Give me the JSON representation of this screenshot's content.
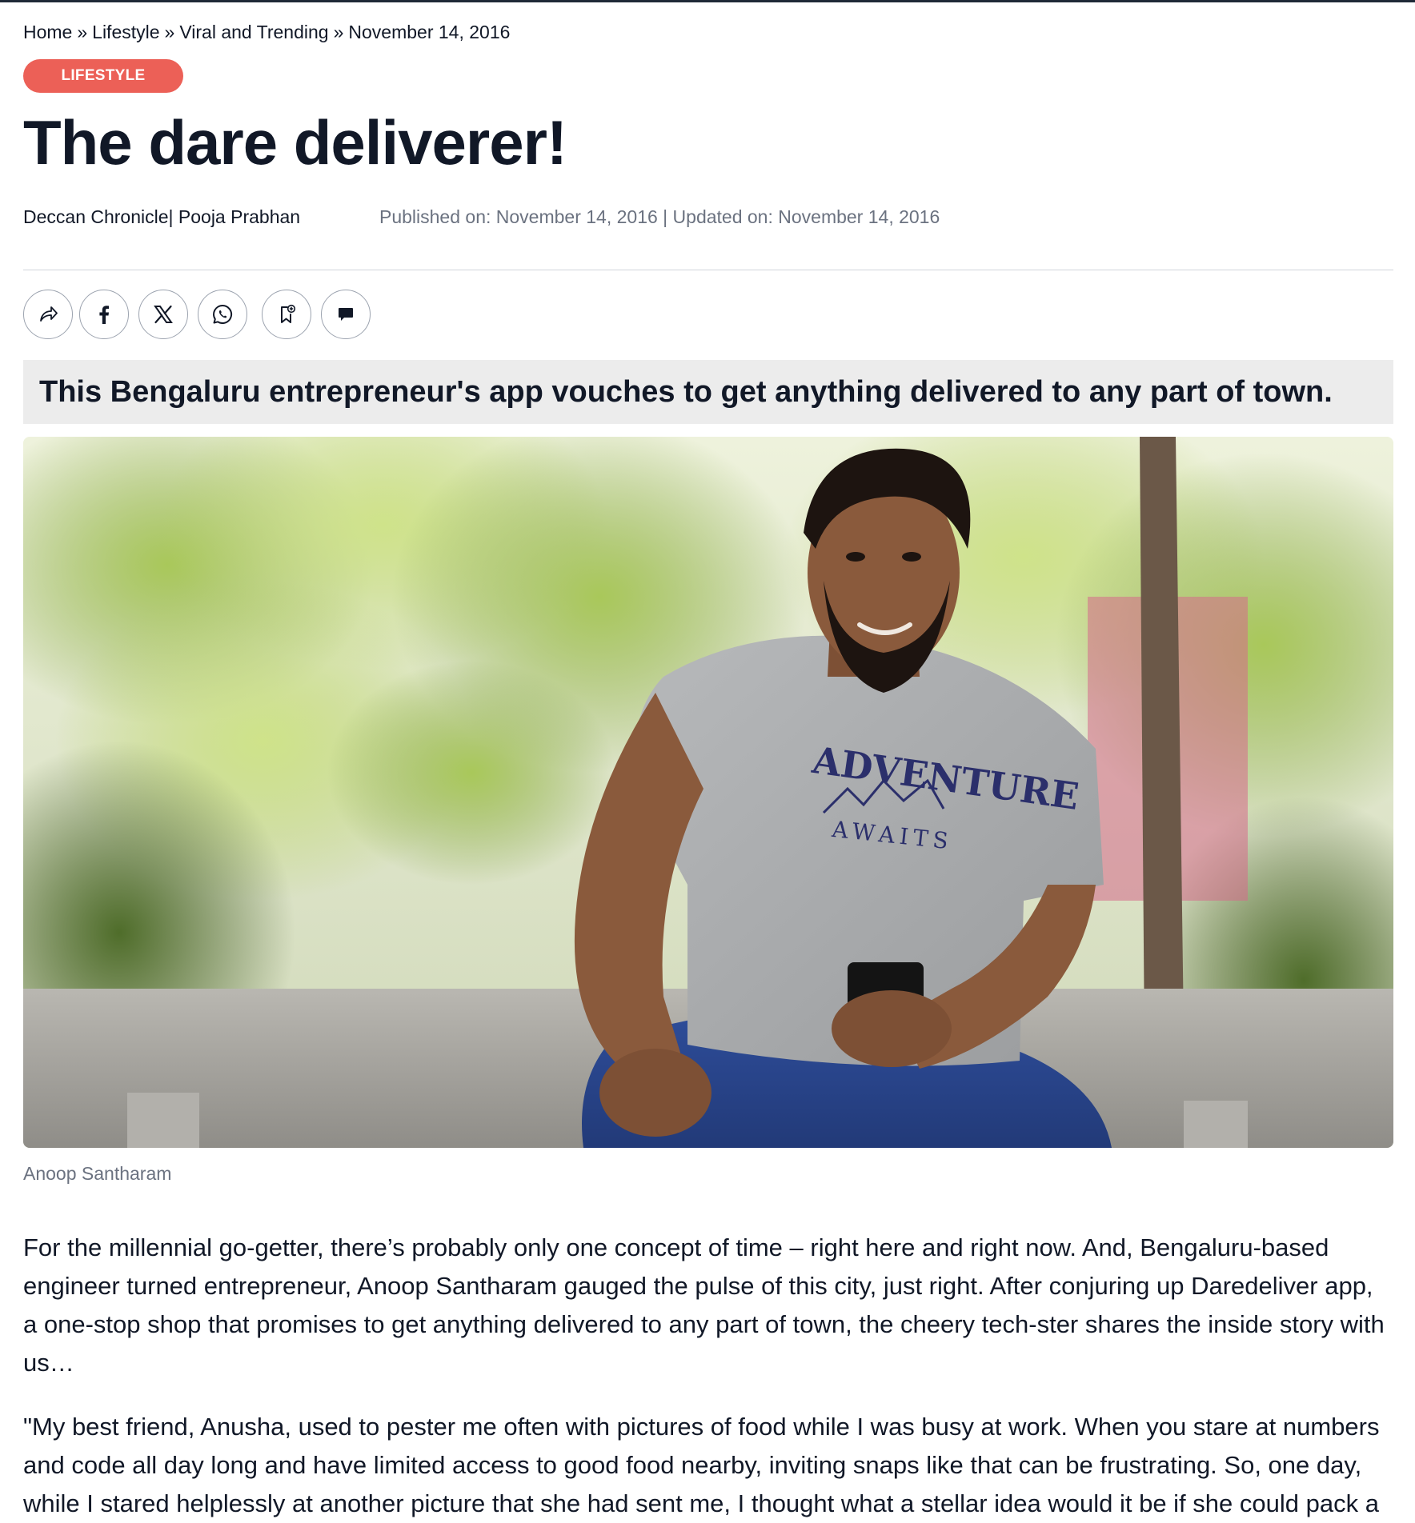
{
  "breadcrumb": {
    "items": [
      "Home",
      "Lifestyle",
      "Viral and Trending",
      "November 14, 2016"
    ],
    "separator": "»"
  },
  "category": "LIFESTYLE",
  "headline": "The dare deliverer!",
  "byline": "Deccan Chronicle| Pooja Prabhan",
  "dates": "Published on: November 14, 2016 | Updated on: November 14, 2016",
  "share": {
    "icons": [
      "share-icon",
      "facebook-icon",
      "x-icon",
      "whatsapp-icon",
      "bookmark-icon",
      "comment-icon"
    ]
  },
  "subheadline": "This Bengaluru entrepreneur's app vouches to get anything delivered to any part of town.",
  "hero": {
    "shirt_text_line1": "ADVENTURE",
    "shirt_text_line2": "AWAITS"
  },
  "caption": "Anoop Santharam",
  "body": {
    "p1": "For the millennial go-getter, there’s probably only one concept of time – right here and right now. And, Bengaluru-based engineer turned entrepreneur, Anoop Santharam gauged the pulse of this city, just right. After conjuring up Daredeliver app, a one-stop shop that promises to get anything delivered to any part of town, the cheery tech-ster shares the inside story with us…",
    "p2": "\"My best friend, Anusha, used to pester me often with pictures of food while I was busy at work. When you stare at numbers and code all day long and have limited access to good food nearby, inviting snaps like that can be frustrating. So, one day, while I stared helplessly at another picture that she had sent me, I thought what a stellar idea would it be if she could  pack a"
  },
  "colors": {
    "badge": "#ec6057",
    "subheadline_bg": "#ececec",
    "text": "#111827",
    "muted": "#6b7280"
  }
}
